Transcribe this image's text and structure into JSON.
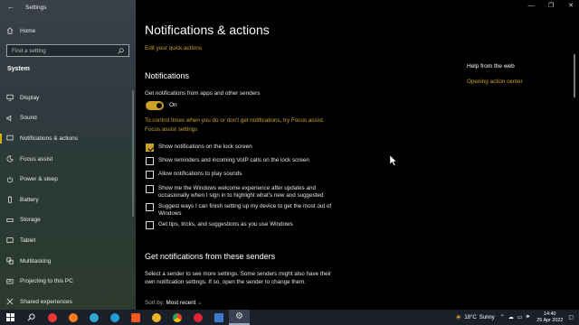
{
  "window": {
    "title": "Settings"
  },
  "sidebar": {
    "home_label": "Home",
    "search_placeholder": "Find a setting",
    "section_heading": "System",
    "items": [
      {
        "label": "Display",
        "icon": "display-icon"
      },
      {
        "label": "Sound",
        "icon": "sound-icon"
      },
      {
        "label": "Notifications & actions",
        "icon": "notifications-icon",
        "active": true
      },
      {
        "label": "Focus assist",
        "icon": "moon-icon"
      },
      {
        "label": "Power & sleep",
        "icon": "power-icon"
      },
      {
        "label": "Battery",
        "icon": "battery-icon"
      },
      {
        "label": "Storage",
        "icon": "storage-icon"
      },
      {
        "label": "Tablet",
        "icon": "tablet-icon"
      },
      {
        "label": "Multitasking",
        "icon": "multitasking-icon"
      },
      {
        "label": "Projecting to this PC",
        "icon": "projecting-icon"
      },
      {
        "label": "Shared experiences",
        "icon": "shared-icon"
      }
    ]
  },
  "main": {
    "page_title": "Notifications & actions",
    "edit_quick_actions": "Edit your quick actions",
    "notifications_heading": "Notifications",
    "get_notifications_label": "Get notifications from apps and other senders",
    "toggle_state": "On",
    "focus_hint": "To control times when you do or don't get notifications, try Focus assist.",
    "focus_link": "Focus assist settings",
    "options": [
      {
        "label": "Show notifications on the lock screen",
        "checked": true
      },
      {
        "label": "Show reminders and incoming VoIP calls on the lock screen",
        "checked": false
      },
      {
        "label": "Allow notifications to play sounds",
        "checked": false
      },
      {
        "label": "Show me the Windows welcome experience after updates and occasionally when I sign in to highlight what's new and suggested",
        "checked": false
      },
      {
        "label": "Suggest ways I can finish setting up my device to get the most out of Windows",
        "checked": false
      },
      {
        "label": "Get tips, tricks, and suggestions as you use Windows",
        "checked": false
      }
    ],
    "senders_heading": "Get notifications from these senders",
    "senders_desc": "Select a sender to see more settings. Some senders might also have their own notification settings. If so, open the sender to change them.",
    "sort_label": "Sort by:",
    "sort_value": "Most recent"
  },
  "help": {
    "title": "Help from the web",
    "link": "Opening action center"
  },
  "taskbar": {
    "weather_temp": "18°C",
    "weather_text": "Sunny",
    "time": "14:40",
    "date": "25 Apr 2022",
    "apps": [
      {
        "icon": "vivaldi-icon",
        "color": "#ef3939"
      },
      {
        "icon": "firefox-icon",
        "color": "#ff7a1a"
      },
      {
        "icon": "edge-icon",
        "color": "#2fa7d8"
      },
      {
        "icon": "edge-dev-icon",
        "color": "#1f9ed6"
      },
      {
        "icon": "brave-icon",
        "color": "#f25c22"
      },
      {
        "icon": "chrome-canary-icon",
        "color": "#f0b429"
      },
      {
        "icon": "chrome-icon",
        "color": "#34a853"
      },
      {
        "icon": "opera-icon",
        "color": "#e0243a"
      },
      {
        "icon": "app-blue-icon",
        "color": "#3a78c9"
      },
      {
        "icon": "settings-icon",
        "color": "#cccccc",
        "active": true
      }
    ]
  },
  "colors": {
    "accent": "#c9a227",
    "sidebar": "#2f3a3f",
    "taskbar": "#1a1f2a"
  }
}
